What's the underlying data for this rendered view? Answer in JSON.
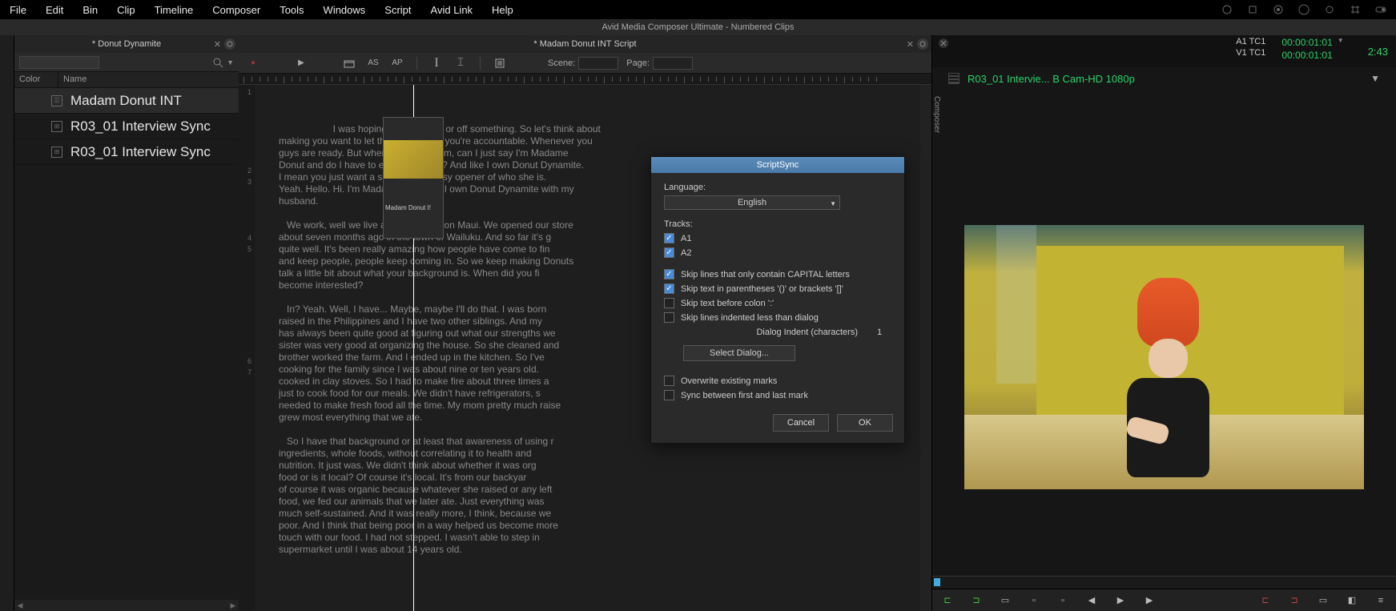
{
  "menubar": {
    "items": [
      "File",
      "Edit",
      "Bin",
      "Clip",
      "Timeline",
      "Composer",
      "Tools",
      "Windows",
      "Script",
      "Avid Link",
      "Help"
    ]
  },
  "app_title": "Avid Media Composer Ultimate - Numbered Clips",
  "bin": {
    "tab_title": "* Donut Dynamite",
    "header": {
      "color": "Color",
      "name": "Name"
    },
    "rows": [
      {
        "name": "Madam Donut INT",
        "selected": true
      },
      {
        "name": "R03_01 Interview Sync",
        "selected": false
      },
      {
        "name": "R03_01 Interview Sync",
        "selected": false
      }
    ]
  },
  "script": {
    "tab_title": "* Madam Donut  INT Script",
    "toolbar": {
      "as": "AS",
      "ap": "AP",
      "scene_label": "Scene:",
      "page_label": "Page:"
    },
    "gutter": [
      "1",
      "",
      "",
      "",
      "",
      "",
      "",
      "2",
      "3",
      "",
      "",
      "",
      "",
      "4",
      "5",
      "",
      "",
      "",
      "",
      "",
      "",
      "",
      "",
      "",
      "6",
      "7"
    ],
    "proxy_label": "Madam Donut I!",
    "text": "   I was hoping that turns on or off something. So let's think about\nmaking you want to let them know that you're accountable. Whenever you\nguys are ready. But when I say who I am, can I just say I'm Madame\nDonut and do I have to expand on that? And like I own Donut Dynamite.\nI mean you just want a short like an easy opener of who she is.\nYeah. Hello. Hi. I'm Madam Donut and I own Donut Dynamite with my\nhusband.\n\n   We work, well we live and work here on Maui. We opened our store\nabout seven months ago in the town of Wailuku. And so far it's g\nquite well. It's been really amazing how people have come to fin\nand keep people, people keep coming in. So we keep making Donuts\ntalk a little bit about what your background is. When did you fi\nbecome interested?\n\n   In? Yeah. Well, I have... Maybe, maybe I'll do that. I was born\nraised in the Philippines and I have two other siblings. And my \nhas always been quite good at figuring out what our strengths we\nsister was very good at organizing the house. So she cleaned and\nbrother worked the farm. And I ended up in the kitchen. So I've \ncooking for the family since I was about nine or ten years old. \ncooked in clay stoves. So I had to make fire about three times a\njust to cook food for our meals. We didn't have refrigerators, s\nneeded to make fresh food all the time. My mom pretty much raise\ngrew most everything that we ate.\n\n   So I have that background or at least that awareness of using r\ningredients, whole foods, without correlating it to health and\nnutrition. It just was. We didn't think about whether it was org\nfood or is it local? Of course it's local. It's from our backyar\nof course it was organic because whatever she raised or any left\nfood, we fed our animals that we later ate. Just everything was \nmuch self-sustained. And it was really more, I think, because we\npoor. And I think that being poor in a way helped us become more\ntouch with our food. I had not stepped. I wasn't able to step in\nsupermarket until I was about 14 years old."
  },
  "composer": {
    "vlabel": "Composer",
    "tc": {
      "a1_label": "A1  TC1",
      "a1_val": "00:00:01:01",
      "v1_label": "V1  TC1",
      "v1_val": "00:00:01:01",
      "remaining": "2:43"
    },
    "clip_name": "R03_01 Intervie... B Cam-HD 1080p"
  },
  "dialog": {
    "title": "ScriptSync",
    "language_label": "Language:",
    "language_value": "English",
    "tracks_label": "Tracks:",
    "tracks": [
      {
        "label": "A1",
        "checked": true
      },
      {
        "label": "A2",
        "checked": true
      }
    ],
    "options": [
      {
        "label": "Skip lines that only contain CAPITAL letters",
        "checked": true
      },
      {
        "label": "Skip text in parentheses '()' or brackets '[]'",
        "checked": true
      },
      {
        "label": "Skip text before colon ':'",
        "checked": false
      },
      {
        "label": "Skip lines indented less than dialog",
        "checked": false
      }
    ],
    "indent_label": "Dialog Indent (characters)",
    "indent_value": "1",
    "select_dialog": "Select Dialog...",
    "options2": [
      {
        "label": "Overwrite existing marks",
        "checked": false
      },
      {
        "label": "Sync between first and last mark",
        "checked": false
      }
    ],
    "cancel": "Cancel",
    "ok": "OK"
  }
}
